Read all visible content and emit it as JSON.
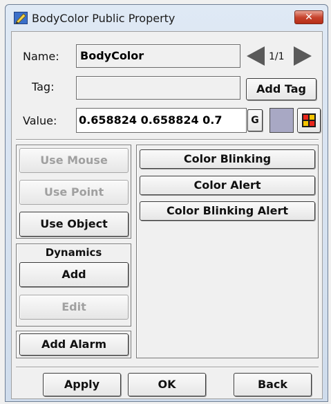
{
  "window": {
    "title": "BodyColor Public Property",
    "close_glyph": "✕"
  },
  "name_row": {
    "label": "Name:",
    "value": "BodyColor",
    "page_indicator": "1/1"
  },
  "tag_row": {
    "label": "Tag:",
    "value": "",
    "add_tag_label": "Add Tag"
  },
  "value_row": {
    "label": "Value:",
    "value": "0.658824 0.658824 0.7",
    "g_button_label": "G",
    "swatch_color": "#a8a8c4"
  },
  "left_panel": {
    "use_mouse": "Use Mouse",
    "use_point": "Use Point",
    "use_object": "Use Object",
    "dynamics_title": "Dynamics",
    "add": "Add",
    "edit": "Edit",
    "add_alarm": "Add Alarm"
  },
  "right_panel": {
    "items": [
      "Color Blinking",
      "Color Alert",
      "Color Blinking Alert"
    ]
  },
  "footer": {
    "apply": "Apply",
    "ok": "OK",
    "back": "Back"
  },
  "icons": {
    "app": "pencil-icon",
    "prev": "arrow-left-icon",
    "next": "arrow-right-icon",
    "palette": "color-palette-icon"
  }
}
